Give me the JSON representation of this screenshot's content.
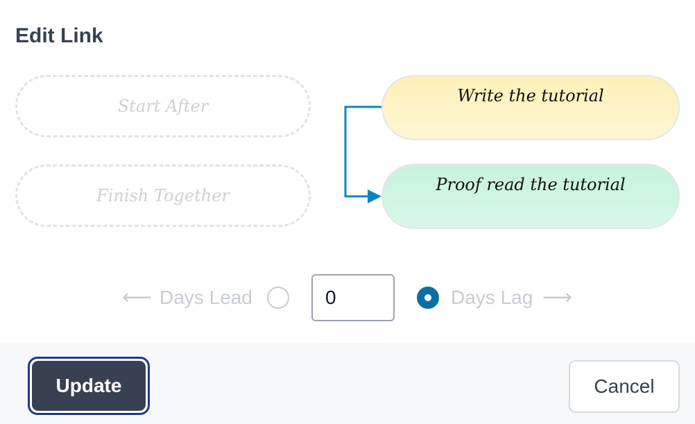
{
  "dialog": {
    "title": "Edit Link"
  },
  "link_types": [
    {
      "label": "Start After"
    },
    {
      "label": "Finish Together"
    }
  ],
  "tasks": {
    "predecessor": "Write the tutorial",
    "successor": "Proof read the tutorial"
  },
  "offset": {
    "lead_label": "Days Lead",
    "lag_label": "Days Lag",
    "value": "0",
    "selected": "lag",
    "lead_arrow_icon": "arrow-left-icon",
    "lag_arrow_icon": "arrow-right-icon"
  },
  "footer": {
    "update_label": "Update",
    "cancel_label": "Cancel"
  },
  "colors": {
    "accent": "#0b6ea4",
    "primary_button": "#374151",
    "focus_ring": "#1d3a8a",
    "predecessor_fill": "#fdf0b8",
    "successor_fill": "#c6f3de"
  }
}
